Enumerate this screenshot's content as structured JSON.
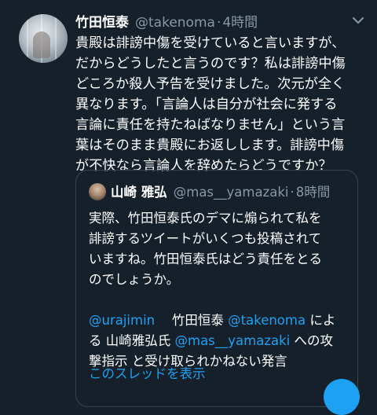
{
  "tweet": {
    "author_name": "竹田恒泰",
    "handle": "@takenoma",
    "separator": "·",
    "time": "4時間",
    "body_lines": [
      "貴殿は誹謗中傷を受けていると言いますが、",
      "だからどうしたと言うのです？私は誹謗中傷",
      "どころか殺人予告を受けました。次元が全く",
      "異なります。「言論人は自分が社会に発する",
      "言論に責任を持たねばなりません」という言",
      "葉はそのまま貴殿にお返しします。誹謗中傷",
      "が不快なら言論人を辞めたらどうですか？"
    ]
  },
  "quoted_tweet": {
    "author_name": "山崎 雅弘",
    "handle": "@mas__yamazaki",
    "separator": "·",
    "time": "8時間",
    "lines": [
      "実際、竹田恒泰氏のデマに煽られて私を",
      "誹謗するツイートがいくつも投稿されて",
      "いますね。竹田恒泰氏はどう責任をとる",
      "のでしょうか。",
      ""
    ],
    "mention_line1": {
      "handle1": "@urajimin",
      "name1": "竹田恒泰",
      "handle2": "@takenoma",
      "suffix": "によ"
    },
    "mention_line2": {
      "prefix": "る 山崎雅弘氏",
      "handle": "@mas__yamazaki",
      "suffix": "への攻"
    },
    "mention_line3": "撃指示 と受け取られかねない発言",
    "show_thread": "このスレッドを表示"
  },
  "colors": {
    "background": "#15202b",
    "text": "#ffffff",
    "secondary": "#8899a6",
    "link": "#1da1f2",
    "border": "#38444d"
  },
  "icons": {
    "menu": "chevron-down-icon",
    "compose": "compose-tweet-icon"
  }
}
